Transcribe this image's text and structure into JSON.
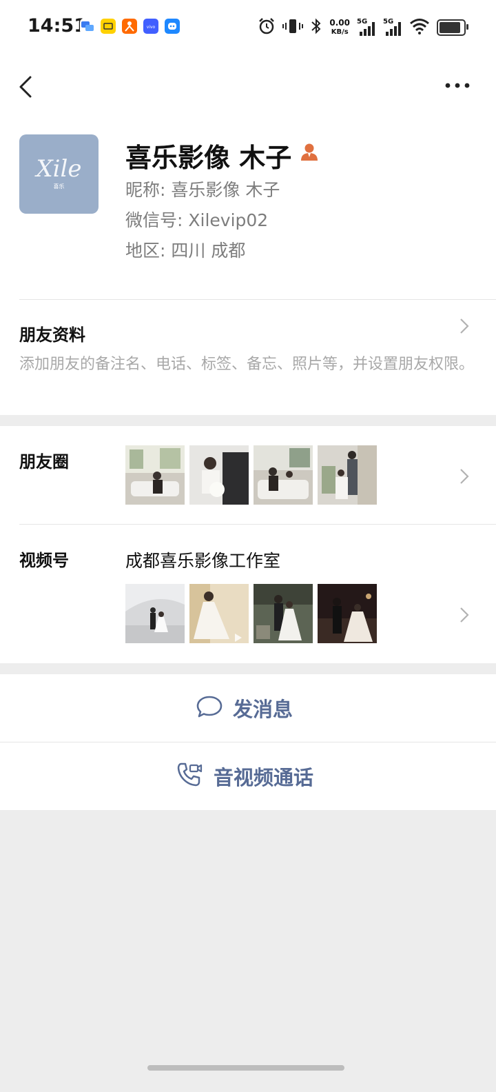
{
  "status_bar": {
    "time": "14:51",
    "speed_value": "0.00",
    "speed_unit": "KB/s",
    "sim1": "5G",
    "sim2": "5G",
    "app_icons": [
      "message-app-icon",
      "meituan-icon",
      "taobao-icon",
      "vivo-icon",
      "assistant-icon"
    ]
  },
  "nav": {
    "back_icon": "chevron-left-icon",
    "more_icon": "more-dots-icon"
  },
  "profile": {
    "display_name": "喜乐影像 木子",
    "nickname": "昵称:  喜乐影像 木子",
    "wechat_id": "微信号:  Xilevip02",
    "region": "地区:  四川  成都",
    "avatar_logo": "Xile",
    "avatar_sub": "喜乐",
    "badge_icon": "user-badge-icon",
    "badge_color": "#e0703f"
  },
  "friend_info": {
    "title": "朋友资料",
    "description": "添加朋友的备注名、电话、标签、备忘、照片等，并设置朋友权限。"
  },
  "moments": {
    "title": "朋友圈",
    "thumbnails": [
      "wedding-photo-1",
      "wedding-photo-2",
      "wedding-photo-3",
      "wedding-photo-4"
    ]
  },
  "channels": {
    "title": "视频号",
    "name": "成都喜乐影像工作室",
    "thumbnails": [
      "channel-video-1",
      "channel-video-2",
      "channel-video-3",
      "channel-video-4"
    ]
  },
  "actions": {
    "message_label": "发消息",
    "call_label": "音视频通话",
    "accent_color": "#576b95"
  }
}
